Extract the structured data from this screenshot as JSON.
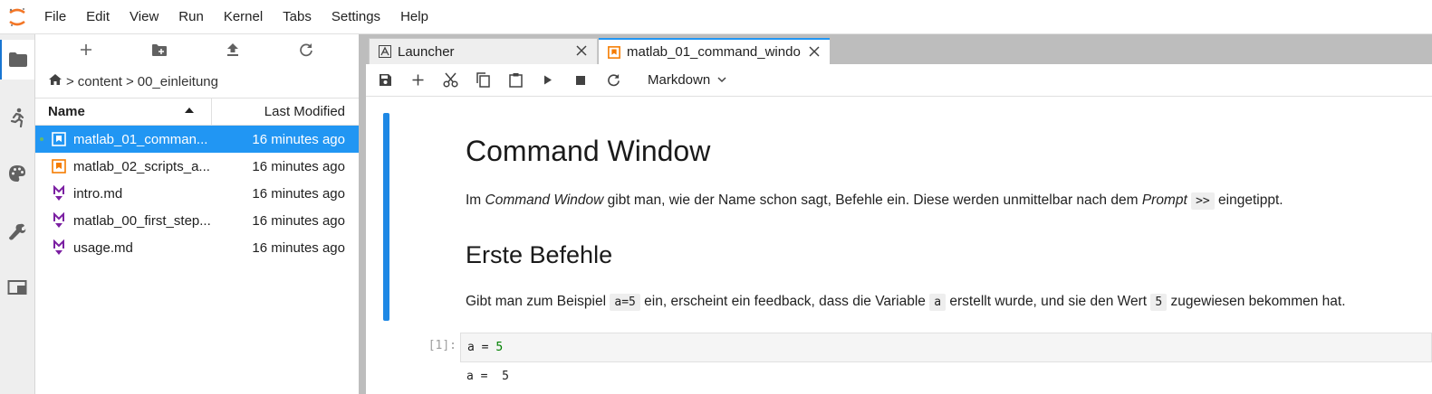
{
  "menubar": {
    "items": [
      "File",
      "Edit",
      "View",
      "Run",
      "Kernel",
      "Tabs",
      "Settings",
      "Help"
    ]
  },
  "activity_bar": {
    "icons": [
      "folder-icon",
      "running-icon",
      "palette-icon",
      "wrench-icon",
      "tabs-icon"
    ],
    "active": "folder-icon"
  },
  "filebrowser": {
    "toolbar_icons": [
      "plus-icon",
      "new-folder-icon",
      "upload-icon",
      "refresh-icon"
    ],
    "breadcrumb": {
      "separator": ">",
      "parts": [
        "content",
        "00_einleitung"
      ]
    },
    "header": {
      "name": "Name",
      "modified": "Last Modified"
    },
    "files": [
      {
        "name": "matlab_01_comman...",
        "modified": "16 minutes ago",
        "type": "notebook",
        "selected": true,
        "running": true
      },
      {
        "name": "matlab_02_scripts_a...",
        "modified": "16 minutes ago",
        "type": "notebook",
        "selected": false,
        "running": false
      },
      {
        "name": "intro.md",
        "modified": "16 minutes ago",
        "type": "markdown",
        "selected": false,
        "running": false
      },
      {
        "name": "matlab_00_first_step...",
        "modified": "16 minutes ago",
        "type": "markdown",
        "selected": false,
        "running": false
      },
      {
        "name": "usage.md",
        "modified": "16 minutes ago",
        "type": "markdown",
        "selected": false,
        "running": false
      }
    ]
  },
  "tabs": [
    {
      "label": "Launcher",
      "active": false
    },
    {
      "label": "matlab_01_command_windo",
      "active": true
    }
  ],
  "notebook_toolbar": {
    "icons": [
      "save-icon",
      "add-cell-icon",
      "cut-icon",
      "copy-icon",
      "paste-icon",
      "run-icon",
      "stop-icon",
      "restart-icon"
    ],
    "cell_type": "Markdown"
  },
  "notebook": {
    "h1": "Command Window",
    "p1": {
      "t1": "Im ",
      "em1": "Command Window",
      "t2": " gibt man, wie der Name schon sagt, Befehle ein. Diese werden unmittelbar nach dem ",
      "em2": "Prompt",
      "t3": " ",
      "code1": ">>",
      "t4": " eingetippt."
    },
    "h2": "Erste Befehle",
    "p2": {
      "t1": "Gibt man zum Beispiel ",
      "code1": "a=5",
      "t2": " ein, erscheint ein feedback, dass die Variable ",
      "code2": "a",
      "t3": " erstellt wurde, und sie den Wert ",
      "code3": "5",
      "t4": " zugewiesen bekommen hat."
    },
    "code_cell": {
      "prompt": "[1]:",
      "code_lhs": "a = ",
      "code_num": "5",
      "output": "a =  5"
    }
  },
  "colors": {
    "accent": "#2196f3",
    "cell_bar": "#1e88e5",
    "notebook_icon": "#f57c00",
    "markdown_icon": "#7b1fa2"
  }
}
